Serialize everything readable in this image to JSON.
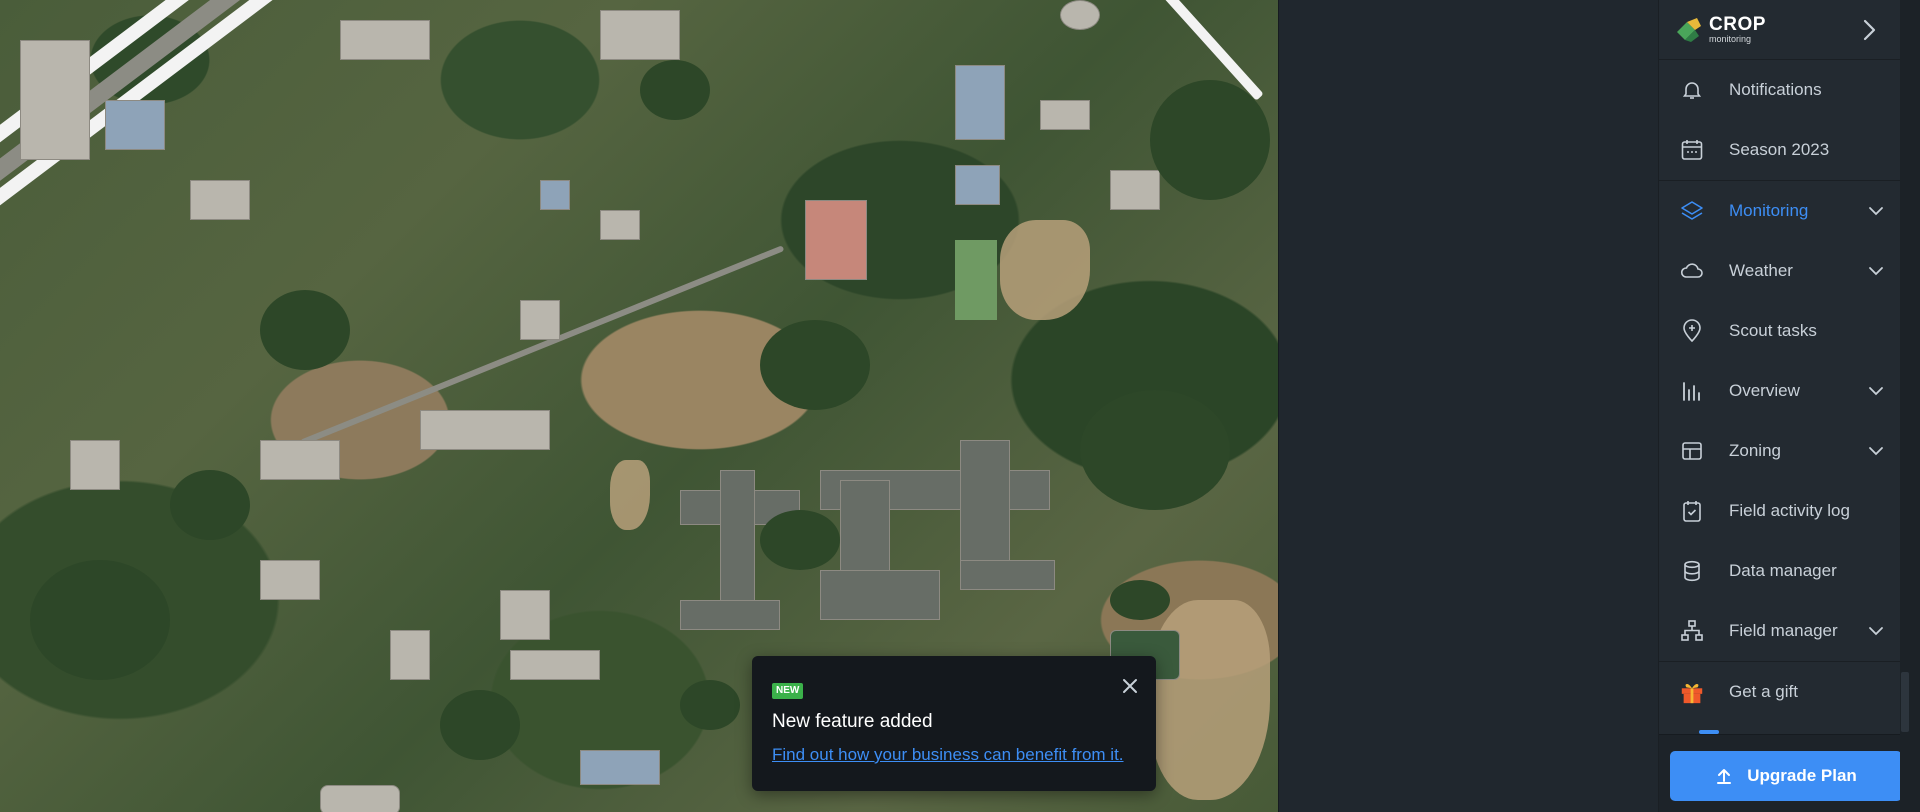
{
  "toast": {
    "badge": "NEW",
    "title": "New feature added",
    "link": "Find out how your business can benefit from it."
  },
  "sidebar": {
    "logo": {
      "title": "CROP",
      "subtitle": "monitoring"
    },
    "items": [
      {
        "label": "Notifications",
        "icon": "bell-icon"
      },
      {
        "label": "Season 2023",
        "icon": "calendar-icon"
      },
      {
        "label": "Monitoring",
        "icon": "layers-icon",
        "active": true,
        "expandable": true
      },
      {
        "label": "Weather",
        "icon": "cloud-icon",
        "expandable": true
      },
      {
        "label": "Scout tasks",
        "icon": "pin-icon"
      },
      {
        "label": "Overview",
        "icon": "bar-chart-icon",
        "expandable": true
      },
      {
        "label": "Zoning",
        "icon": "layout-icon",
        "expandable": true
      },
      {
        "label": "Field activity log",
        "icon": "clipboard-check-icon"
      },
      {
        "label": "Data manager",
        "icon": "database-icon"
      },
      {
        "label": "Field manager",
        "icon": "hierarchy-icon",
        "expandable": true
      },
      {
        "label": "Get a gift",
        "icon": "gift-icon"
      }
    ],
    "upgrade_label": "Upgrade Plan"
  },
  "colors": {
    "accent": "#3d8ef5",
    "sidebar_bg": "#232a31",
    "badge_green": "#3bb14a"
  }
}
